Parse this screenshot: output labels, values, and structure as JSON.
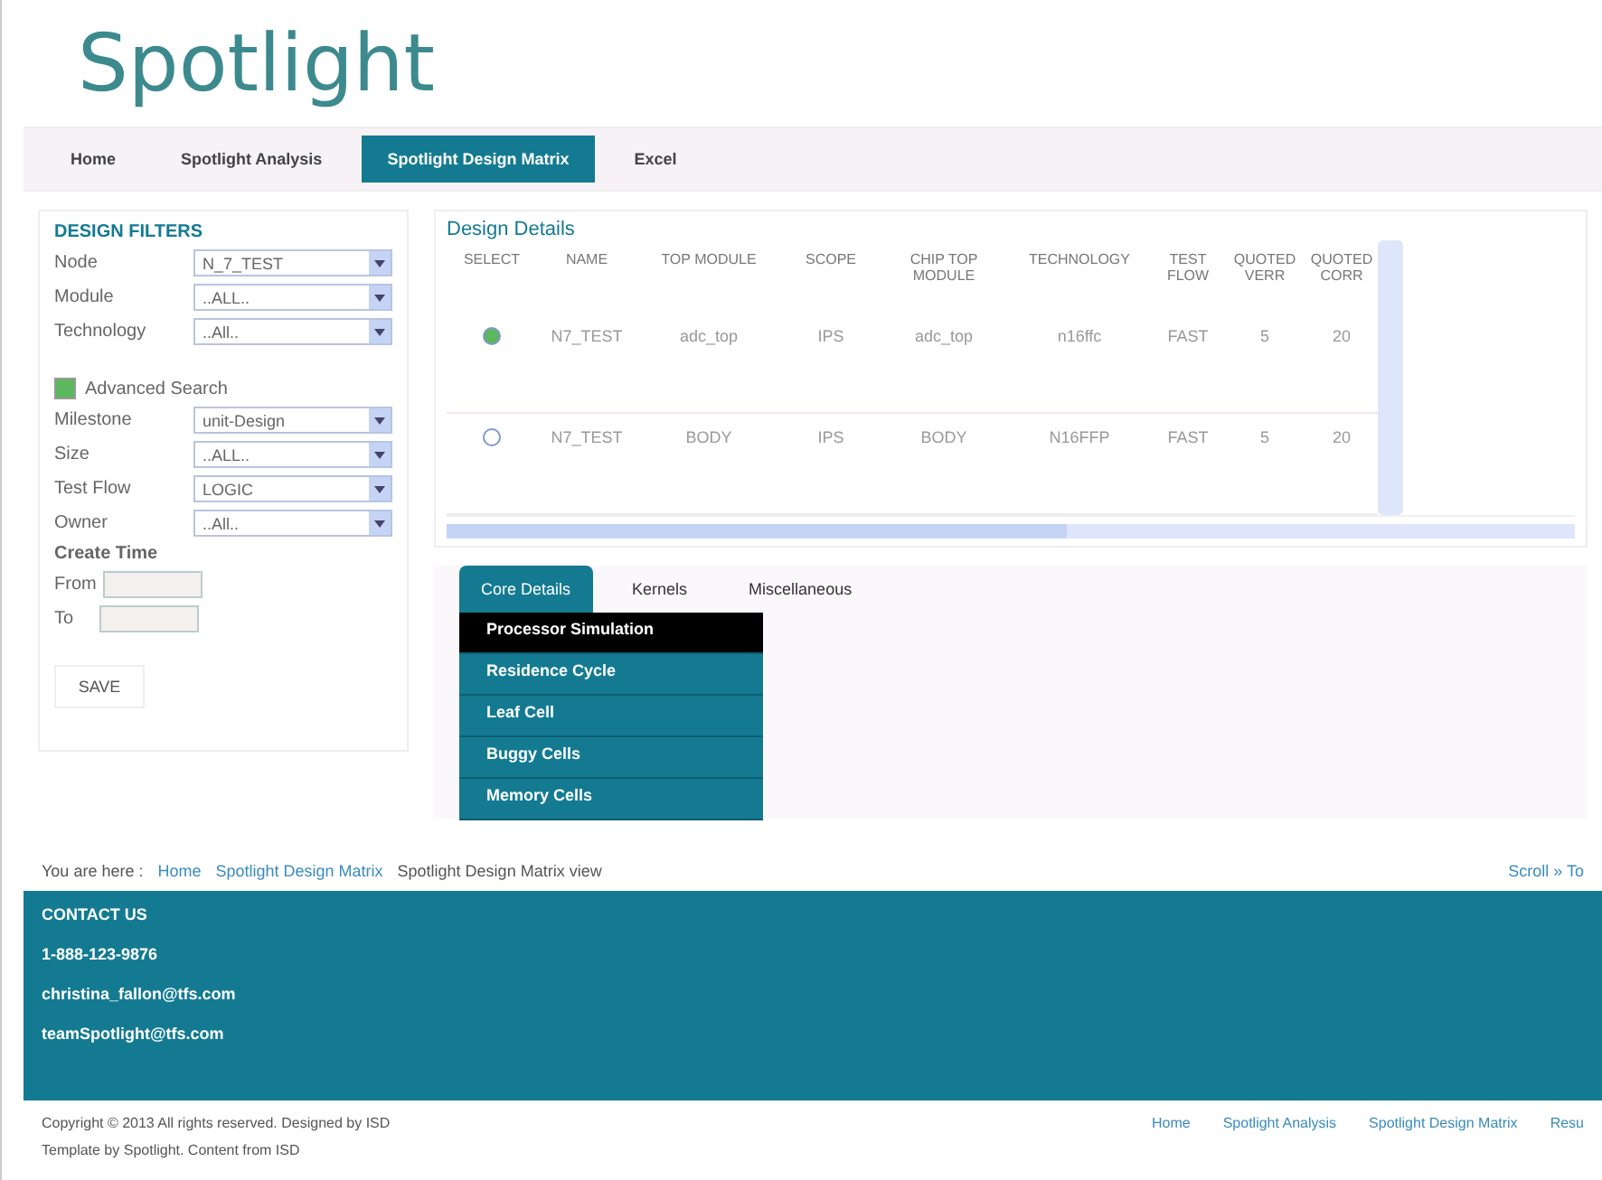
{
  "logo": {
    "text": "Spotlight"
  },
  "nav": [
    {
      "label": "Home",
      "selected": false
    },
    {
      "label": "Spotlight Analysis",
      "selected": false
    },
    {
      "label": "Spotlight Design Matrix",
      "selected": true
    },
    {
      "label": "Excel",
      "selected": false
    }
  ],
  "filters": {
    "title": "DESIGN FILTERS",
    "basic": [
      {
        "label": "Node",
        "value": "N_7_TEST"
      },
      {
        "label": "Module",
        "value": "..ALL.."
      },
      {
        "label": "Technology",
        "value": "..All.."
      }
    ],
    "advanced": {
      "label": "Advanced Search",
      "checked": true
    },
    "extra": [
      {
        "label": "Milestone",
        "value": "unit-Design"
      },
      {
        "label": "Size",
        "value": "..ALL.."
      },
      {
        "label": "Test Flow",
        "value": "LOGIC"
      },
      {
        "label": "Owner",
        "value": "..All.."
      }
    ],
    "create_time": {
      "label": "Create Time",
      "from": "From",
      "to": "To"
    },
    "button": "SAVE"
  },
  "design": {
    "title": "Design Details",
    "columns": [
      "SELECT",
      "NAME",
      "TOP MODULE",
      "SCOPE",
      "CHIP TOP MODULE",
      "TECHNOLOGY",
      "TEST FLOW",
      "QUOTED VERR",
      "QUOTED CORR"
    ],
    "rows": [
      {
        "selected": true,
        "cells": [
          "",
          "N7_TEST",
          "adc_top",
          "IPS",
          "adc_top",
          "n16ffc",
          "FAST",
          "5",
          "20"
        ]
      },
      {
        "selected": false,
        "cells": [
          "",
          "N7_TEST",
          "BODY",
          "IPS",
          "BODY",
          "N16FFP",
          "FAST",
          "5",
          "20"
        ]
      }
    ]
  },
  "detail_tabs": [
    {
      "label": "Core Details",
      "selected": true
    },
    {
      "label": "Kernels",
      "selected": false
    },
    {
      "label": "Miscellaneous",
      "selected": false
    }
  ],
  "menu": [
    {
      "label": "Processor Simulation",
      "selected": true
    },
    {
      "label": "Residence Cycle",
      "selected": false
    },
    {
      "label": "Leaf Cell",
      "selected": false
    },
    {
      "label": "Buggy Cells",
      "selected": false
    },
    {
      "label": "Memory Cells",
      "selected": false
    }
  ],
  "breadcrumb": {
    "prefix": "You are here :",
    "links": [
      "Home",
      "Spotlight Design Matrix"
    ],
    "current": "Spotlight Design Matrix view",
    "right": "Scroll » To"
  },
  "contact": {
    "title": "CONTACT US",
    "lines": [
      "1-888-123-9876",
      "christina_fallon@tfs.com",
      "teamSpotlight@tfs.com"
    ]
  },
  "bottom": {
    "copyright": "Copyright © 2013 All rights reserved. Designed by ISD",
    "template": "Template by Spotlight. Content from ISD",
    "links": [
      "Home",
      "Spotlight Analysis",
      "Spotlight Design Matrix",
      "Resu"
    ]
  }
}
